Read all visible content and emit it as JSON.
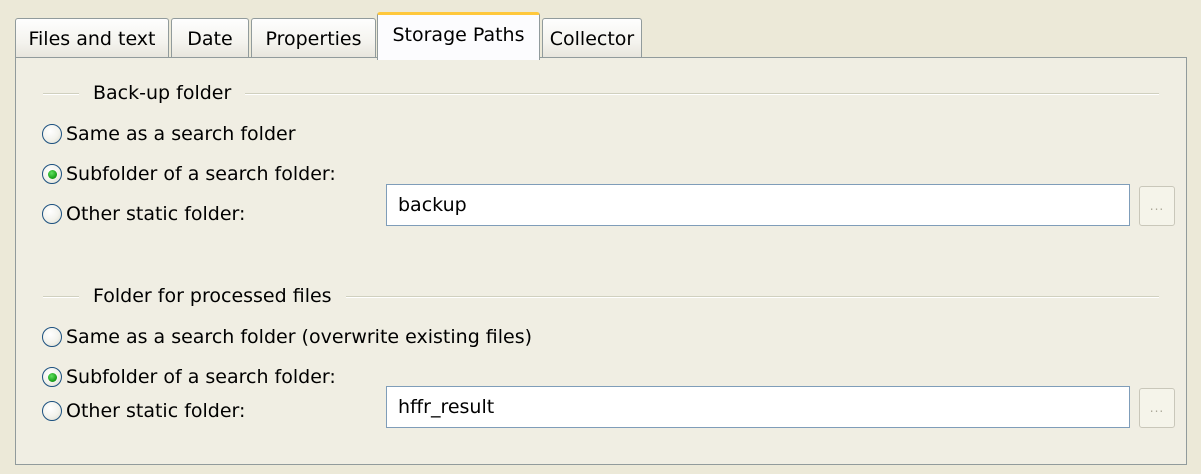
{
  "tabs": [
    {
      "label": "Files and text",
      "active": false
    },
    {
      "label": "Date",
      "active": false
    },
    {
      "label": "Properties",
      "active": false
    },
    {
      "label": "Storage Paths",
      "active": true
    },
    {
      "label": "Collector",
      "active": false
    }
  ],
  "backup_group": {
    "title": "Back-up folder",
    "options": [
      {
        "label": "Same as a search folder",
        "selected": false
      },
      {
        "label": "Subfolder of a search folder:",
        "selected": true
      },
      {
        "label": "Other static folder:",
        "selected": false
      }
    ],
    "folder_value": "backup",
    "browse_label": "...",
    "browse_enabled": false
  },
  "processed_group": {
    "title": "Folder for processed files",
    "options": [
      {
        "label": "Same as a search folder (overwrite existing files)",
        "selected": false
      },
      {
        "label": "Subfolder of a search folder:",
        "selected": true
      },
      {
        "label": "Other static folder:",
        "selected": false
      }
    ],
    "folder_value": "hffr_result",
    "browse_label": "...",
    "browse_enabled": false
  },
  "colors": {
    "window_bg": "#ece9d8",
    "active_tab_accent": "#ffc83c",
    "radio_border": "#1c5180",
    "radio_selected": "#1fa51f",
    "field_border": "#7f9db9"
  }
}
